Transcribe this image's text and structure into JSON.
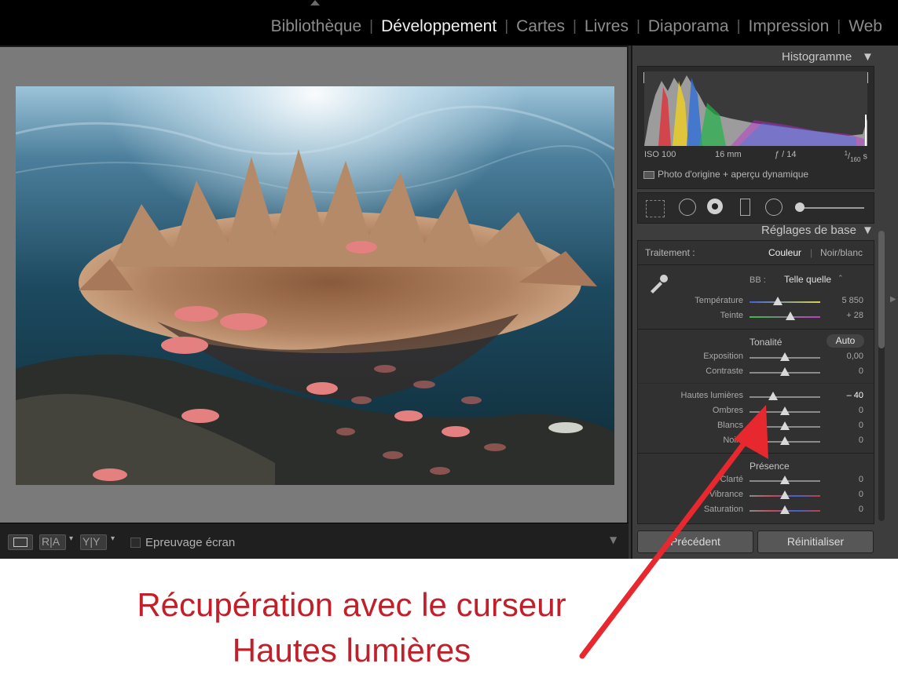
{
  "modules": [
    "Bibliothèque",
    "Développement",
    "Cartes",
    "Livres",
    "Diaporama",
    "Impression",
    "Web"
  ],
  "active_module": "Développement",
  "toolbar": {
    "proof_label": "Epreuvage écran",
    "view_ra": "R|A",
    "view_yy": "Y|Y"
  },
  "histogram": {
    "title": "Histogramme",
    "iso": "ISO 100",
    "focal": "16 mm",
    "aperture": "ƒ / 14",
    "shutter_num": "1",
    "shutter_den": "160",
    "shutter_unit": "s",
    "preview_label": "Photo d'origine + aperçu dynamique"
  },
  "basic": {
    "title": "Réglages de base",
    "treatment_label": "Traitement :",
    "treatment_color": "Couleur",
    "treatment_bw": "Noir/blanc",
    "wb_label": "BB :",
    "wb_value": "Telle quelle",
    "tone_title": "Tonalité",
    "auto_label": "Auto",
    "presence_title": "Présence",
    "sliders": {
      "temperature": {
        "label": "Température",
        "value": "5 850",
        "pos": 0.4
      },
      "tint": {
        "label": "Teinte",
        "value": "+ 28",
        "pos": 0.58
      },
      "exposure": {
        "label": "Exposition",
        "value": "0,00",
        "pos": 0.5
      },
      "contrast": {
        "label": "Contraste",
        "value": "0",
        "pos": 0.5
      },
      "highlights": {
        "label": "Hautes lumières",
        "value": "– 40",
        "pos": 0.33
      },
      "shadows": {
        "label": "Ombres",
        "value": "0",
        "pos": 0.5
      },
      "whites": {
        "label": "Blancs",
        "value": "0",
        "pos": 0.5
      },
      "blacks": {
        "label": "Noirs",
        "value": "0",
        "pos": 0.5
      },
      "clarity": {
        "label": "Clarté",
        "value": "0",
        "pos": 0.5
      },
      "vibrance": {
        "label": "Vibrance",
        "value": "0",
        "pos": 0.5
      },
      "saturation": {
        "label": "Saturation",
        "value": "0",
        "pos": 0.5
      }
    }
  },
  "buttons": {
    "previous": "Précédent",
    "reset": "Réinitialiser"
  },
  "caption": {
    "line1": "Récupération avec le curseur",
    "line2": "Hautes lumières"
  },
  "colors": {
    "caption": "#c1202b",
    "arrow": "#e8282f"
  }
}
